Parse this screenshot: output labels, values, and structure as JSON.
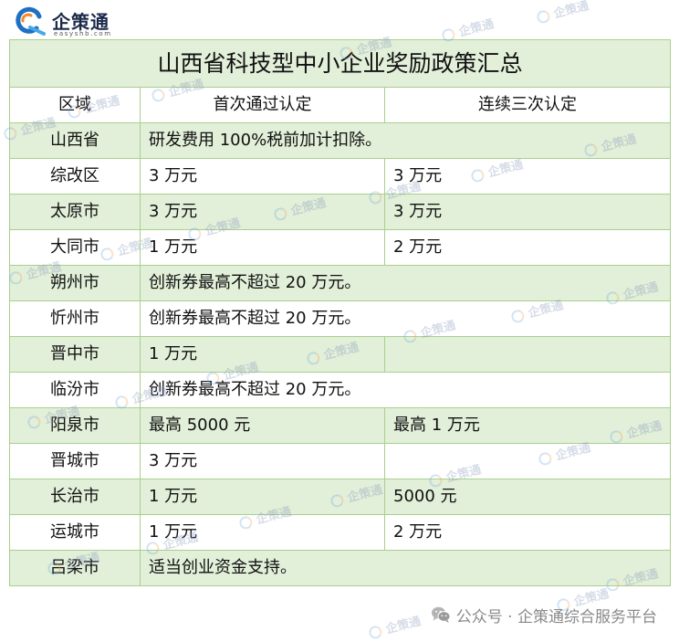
{
  "logo": {
    "name": "企策通",
    "domain": "easyshb.com",
    "icon": "qicetong-logo-icon"
  },
  "table": {
    "title": "山西省科技型中小企业奖励政策汇总",
    "headers": {
      "region": "区域",
      "first": "首次通过认定",
      "third": "连续三次认定"
    },
    "rows": [
      {
        "region": "山西省",
        "merged": "研发费用 100%税前加计扣除。"
      },
      {
        "region": "综改区",
        "first": "3 万元",
        "third": "3 万元"
      },
      {
        "region": "太原市",
        "first": "3 万元",
        "third": "3 万元"
      },
      {
        "region": "大同市",
        "first": "1 万元",
        "third": "2 万元"
      },
      {
        "region": "朔州市",
        "merged": "创新券最高不超过 20 万元。"
      },
      {
        "region": "忻州市",
        "merged": "创新券最高不超过 20 万元。"
      },
      {
        "region": "晋中市",
        "first": "1 万元",
        "third": ""
      },
      {
        "region": "临汾市",
        "merged": "创新券最高不超过 20 万元。"
      },
      {
        "region": "阳泉市",
        "first": "最高 5000 元",
        "third": "最高 1 万元"
      },
      {
        "region": "晋城市",
        "first": "3 万元",
        "third": ""
      },
      {
        "region": "长治市",
        "first": "1 万元",
        "third": "5000 元"
      },
      {
        "region": "运城市",
        "first": "1 万元",
        "third": "2 万元"
      },
      {
        "region": "吕梁市",
        "merged": "适当创业资金支持。"
      }
    ]
  },
  "footer": {
    "text": "公众号 · 企策通综合服务平台",
    "icon": "wechat-icon"
  },
  "watermark": {
    "text": "企策通"
  },
  "colors": {
    "title_bg": "#e2efd9",
    "stripe_bg": "#e2efd9",
    "border": "#a8d08d",
    "brand_blue": "#1f6fc5",
    "brand_orange": "#f08a24",
    "footer_text": "#8a8a8a"
  }
}
